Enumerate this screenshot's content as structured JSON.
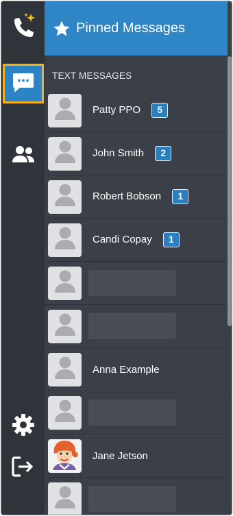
{
  "rail": {
    "items": [
      {
        "name": "phone-sparkle-icon"
      },
      {
        "name": "messages-icon",
        "active": true
      },
      {
        "name": "contacts-icon"
      },
      {
        "name": "settings-icon"
      },
      {
        "name": "logout-icon"
      }
    ]
  },
  "pinned": {
    "title": "Pinned Messages",
    "icon": "star-icon"
  },
  "section": {
    "title": "TEXT MESSAGES"
  },
  "conversations": [
    {
      "name": "Patty PPO",
      "badge": "5"
    },
    {
      "name": "John Smith",
      "badge": "2"
    },
    {
      "name": "Robert Bobson",
      "badge": "1"
    },
    {
      "name": "Candi Copay",
      "badge": "1"
    },
    {
      "name": "",
      "redacted": true
    },
    {
      "name": "",
      "redacted": true
    },
    {
      "name": "Anna Example"
    },
    {
      "name": "",
      "redacted": true
    },
    {
      "name": "Jane Jetson",
      "avatar": "jane-jetson-photo"
    },
    {
      "name": "",
      "redacted": true
    }
  ],
  "colors": {
    "accent": "#2e86c6",
    "active_outline": "#f5b01c",
    "rail_bg": "#2f343b",
    "panel_bg": "#3b4048"
  }
}
